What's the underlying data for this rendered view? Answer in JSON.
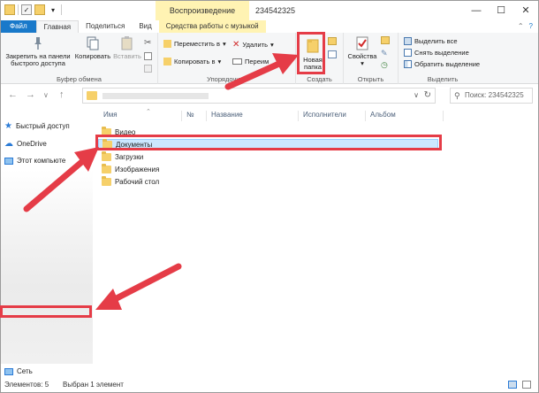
{
  "titlebar": {
    "context_tab": "Воспроизведение",
    "title": "234542325",
    "controls": [
      "—",
      "☐",
      "✕"
    ]
  },
  "tabs": {
    "file": "Файл",
    "home": "Главная",
    "share": "Поделиться",
    "view": "Вид",
    "music_tools": "Средства работы с музыкой"
  },
  "ribbon": {
    "clipboard": {
      "label": "Буфер обмена",
      "pin": "Закрепить на панели быстрого доступа",
      "copy": "Копировать",
      "paste": "Вставить"
    },
    "organize": {
      "label": "Упорядочить",
      "move_to": "Переместить в",
      "copy_to": "Копировать в",
      "delete": "Удалить",
      "rename": "Переим"
    },
    "create": {
      "label": "Создать",
      "new_folder_line1": "Новая",
      "new_folder_line2": "папка"
    },
    "open": {
      "label": "Открыть",
      "properties": "Свойства"
    },
    "select": {
      "label": "Выделить",
      "select_all": "Выделить все",
      "select_none": "Снять выделение",
      "invert": "Обратить выделение"
    }
  },
  "search": {
    "placeholder": "Поиск: 234542325"
  },
  "navpane": {
    "quick_access": "Быстрый доступ",
    "onedrive": "OneDrive",
    "this_pc": "Этот компьюте",
    "network": "Сеть"
  },
  "columns": {
    "name": "Имя",
    "number": "№",
    "title": "Название",
    "artists": "Исполнители",
    "album": "Альбом"
  },
  "files": [
    {
      "name": "Видео",
      "selected": false
    },
    {
      "name": "Документы",
      "selected": true
    },
    {
      "name": "Загрузки",
      "selected": false
    },
    {
      "name": "Изображения",
      "selected": false
    },
    {
      "name": "Рабочий стол",
      "selected": false
    }
  ],
  "status": {
    "items": "Элементов: 5",
    "selected": "Выбран 1 элемент"
  },
  "colors": {
    "accent": "#1979ca",
    "annotation": "#e53c47",
    "selection": "#cce8ff",
    "folder": "#f6d06a"
  }
}
